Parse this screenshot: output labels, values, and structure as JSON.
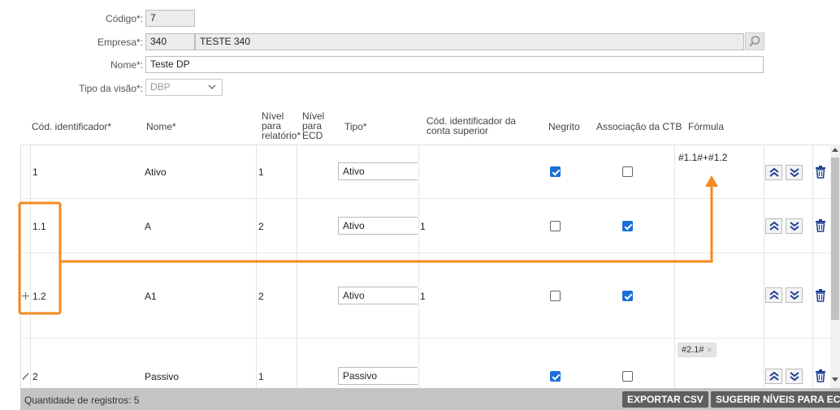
{
  "form": {
    "codigo_label": "Código*:",
    "codigo_value": "7",
    "empresa_label": "Empresa*:",
    "empresa_code": "340",
    "empresa_name": "TESTE 340",
    "nome_label": "Nome*:",
    "nome_value": "Teste DP",
    "tipo_visao_label": "Tipo da visão*:",
    "tipo_visao_value": "DBP"
  },
  "columns": {
    "cod_identificador": "Cód. identificador*",
    "nome": "Nome*",
    "nivel_relatorio": [
      "Nível",
      "para",
      "relatório*"
    ],
    "nivel_ecd": [
      "Nível",
      "para",
      "ECD"
    ],
    "tipo": "Tipo*",
    "cod_superior": [
      "Cód. identificador da",
      "conta superior"
    ],
    "negrito": "Negrito",
    "associacao_ctb": "Associação da CTB",
    "formula": "Fórmula"
  },
  "rows": [
    {
      "cod": "1",
      "nome": "Ativo",
      "nivel": "1",
      "tipo": "Ativo",
      "superior": "",
      "negrito": true,
      "associacao": false,
      "formula": "#1.1#+#1.2"
    },
    {
      "cod": "1.1",
      "nome": "A",
      "nivel": "2",
      "tipo": "Ativo",
      "superior": "1",
      "negrito": false,
      "associacao": true,
      "formula": ""
    },
    {
      "cod": "1.2",
      "nome": "A1",
      "nivel": "2",
      "tipo": "Ativo",
      "superior": "1",
      "negrito": false,
      "associacao": true,
      "formula": ""
    },
    {
      "cod": "2",
      "nome": "Passivo",
      "nivel": "1",
      "tipo": "Passivo",
      "superior": "",
      "negrito": true,
      "associacao": false,
      "formula_tag": "#2.1#"
    }
  ],
  "footer": {
    "count_text": "Quantidade de registros: 5",
    "export_csv": "EXPORTAR CSV",
    "sugerir_niveis": "SUGERIR NÍVEIS PARA ECD"
  },
  "colors": {
    "checkbox_checked": "#1a6fd8",
    "annotation": "#f5891f",
    "footer_bar": "#c4c4c4",
    "footer_button": "#5f5f5f",
    "arrow_icon": "#1f3f93"
  }
}
